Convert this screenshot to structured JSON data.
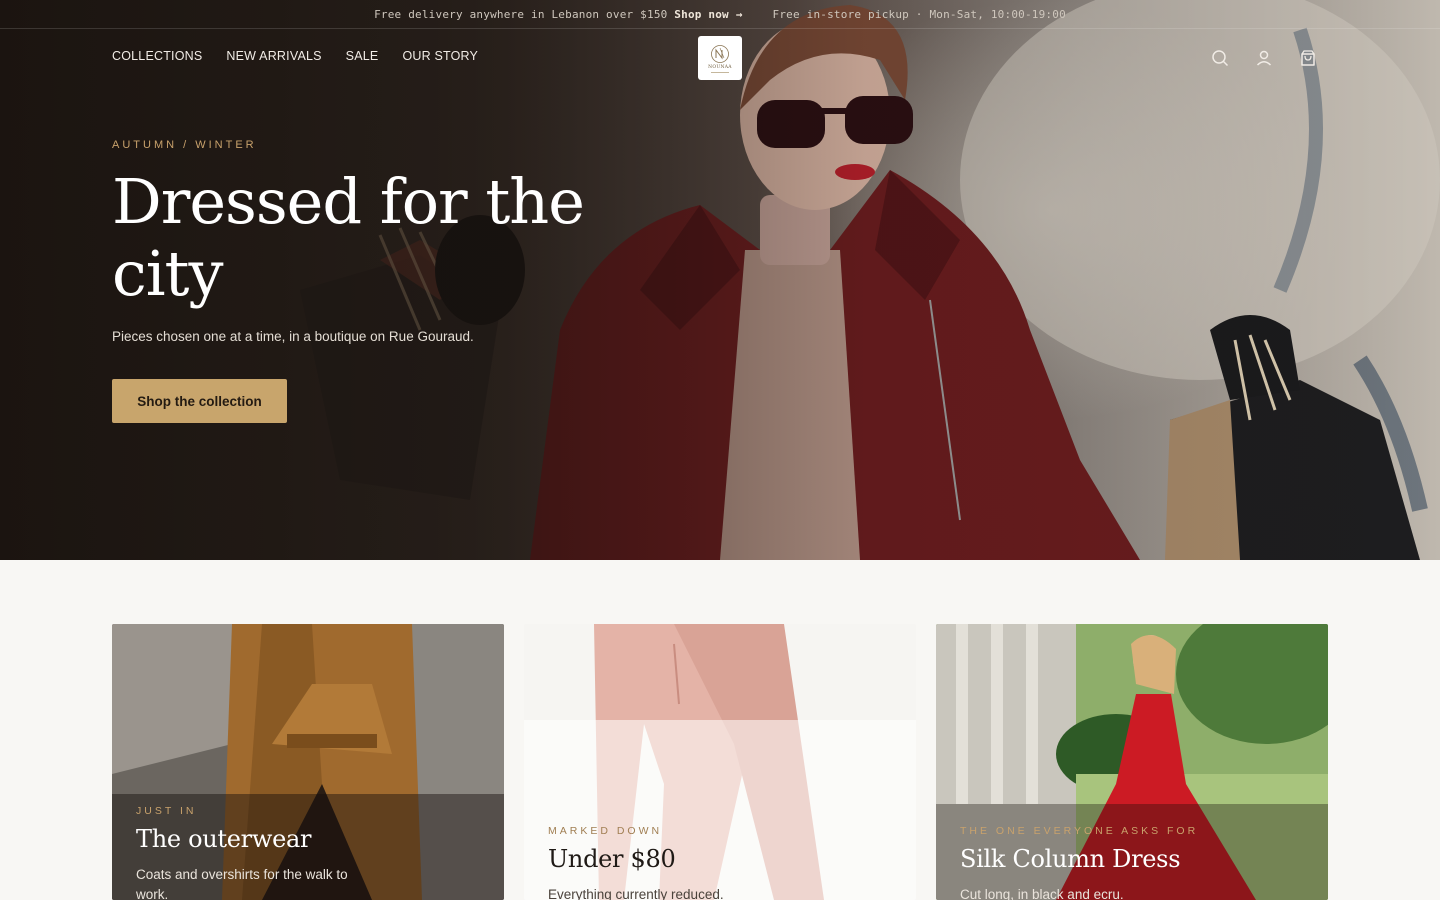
{
  "announcement": {
    "delivery_text": "Free delivery anywhere in Lebanon over $150",
    "delivery_link": "Shop now →",
    "pickup_text": "Free in-store pickup · Mon-Sat, 10:00-19:00"
  },
  "nav": {
    "items": [
      {
        "label": "COLLECTIONS"
      },
      {
        "label": "NEW ARRIVALS"
      },
      {
        "label": "SALE"
      },
      {
        "label": "OUR STORY"
      }
    ]
  },
  "logo": {
    "wordmark": "NOUNAA"
  },
  "header_icons": [
    "search-icon",
    "account-icon",
    "cart-icon"
  ],
  "hero": {
    "eyebrow": "AUTUMN / WINTER",
    "headline": "Dressed for the city",
    "subline": "Pieces chosen one at a time, in a boutique on Rue Gouraud.",
    "cta": "Shop the collection"
  },
  "cards": [
    {
      "eyebrow": "JUST IN",
      "title": "The outerwear",
      "desc": "Coats and overshirts for the walk to work."
    },
    {
      "eyebrow": "MARKED DOWN",
      "title": "Under $80",
      "desc": "Everything currently reduced."
    },
    {
      "eyebrow": "THE ONE EVERYONE ASKS FOR",
      "title": "Silk Column Dress",
      "desc": "Cut long, in black and ecru."
    }
  ],
  "colors": {
    "accent_gold": "#c8a56c",
    "page_bg": "#f8f7f4",
    "hero_dark": "#2d2520"
  }
}
